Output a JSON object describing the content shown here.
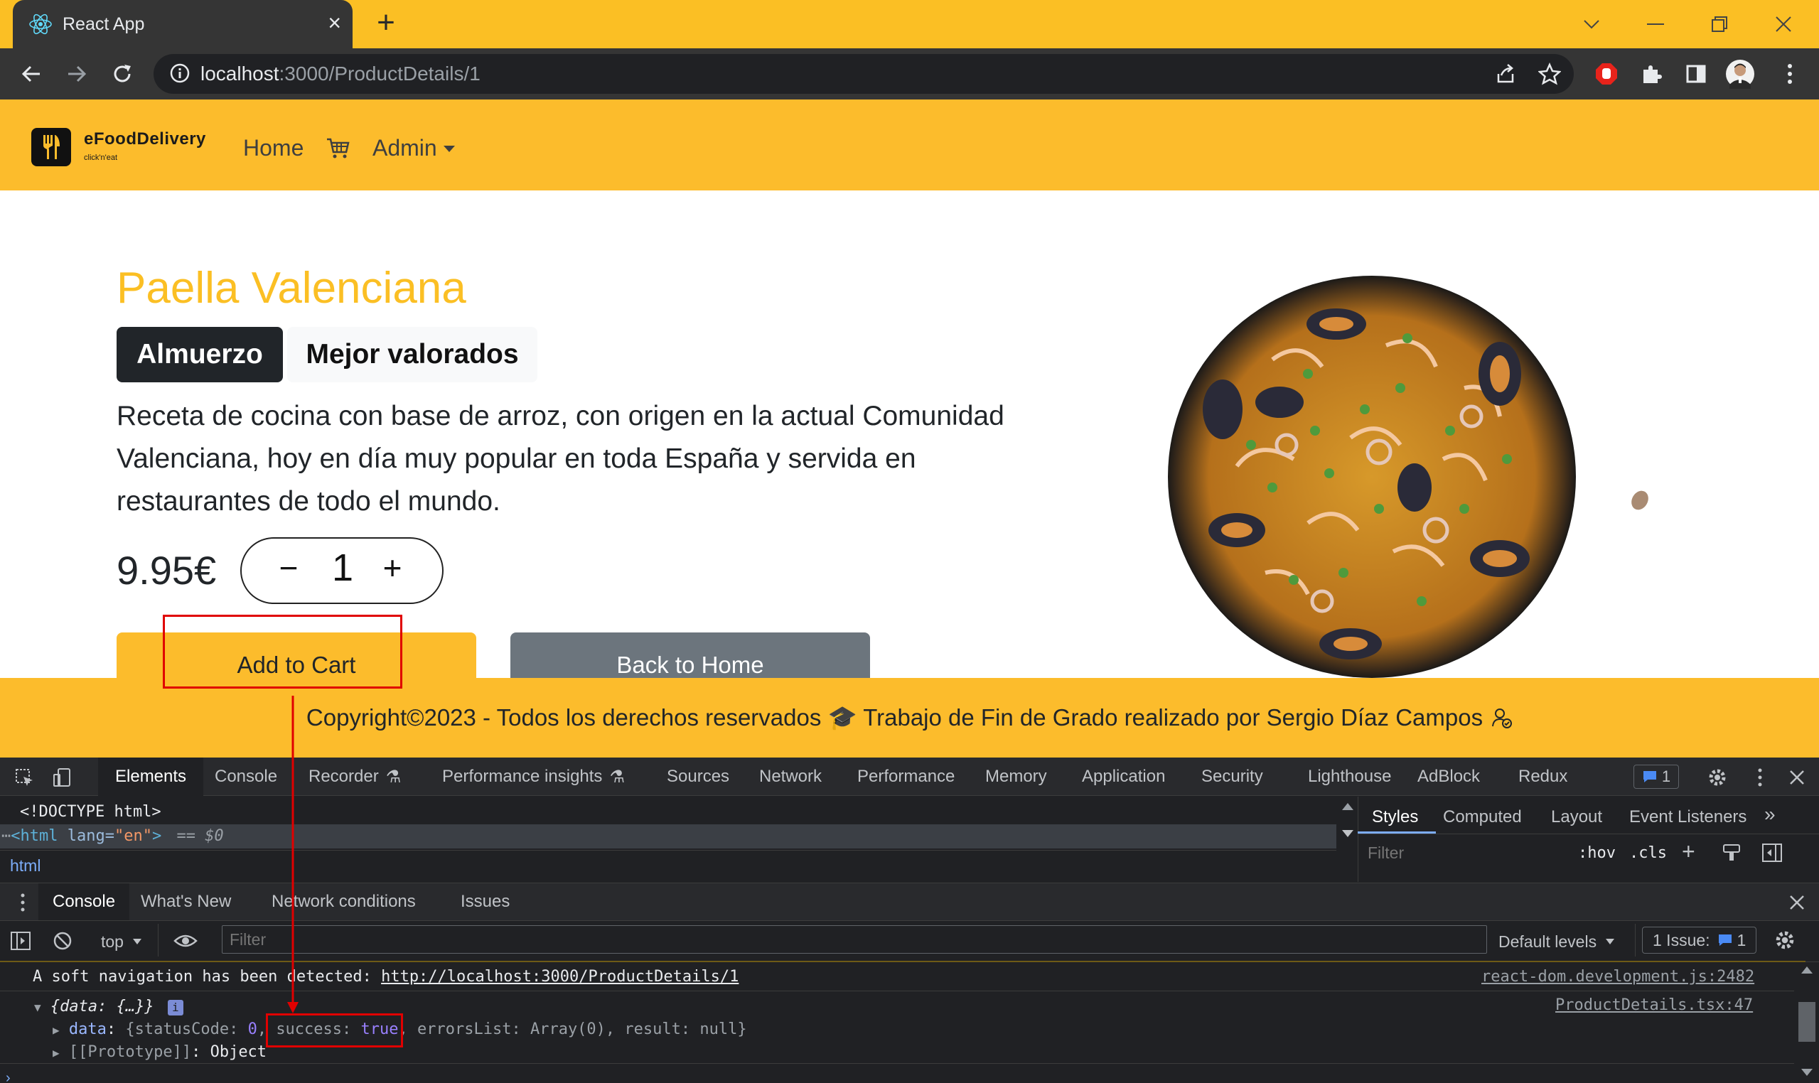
{
  "browser": {
    "tab_title": "React App",
    "url_host": "localhost",
    "url_path": ":3000/ProductDetails/1"
  },
  "navbar": {
    "brand": "eFoodDelivery",
    "brand_tagline": "click'n'eat",
    "home": "Home",
    "admin": "Admin"
  },
  "product": {
    "name": "Paella Valenciana",
    "category": "Almuerzo",
    "special_tag": "Mejor valorados",
    "description": "Receta de cocina con base de arroz, con origen en la actual Comunidad Valenciana, hoy en día muy popular en toda España y servida en restaurantes de todo el mundo.",
    "price": "9.95€",
    "quantity": "1",
    "add_to_cart": "Add to Cart",
    "back_home": "Back to Home"
  },
  "footer": {
    "text": "Copyright©2023 - Todos los derechos reservados 🎓 Trabajo de Fin de Grado realizado por Sergio Díaz Campos"
  },
  "devtools": {
    "tabs": [
      "Elements",
      "Console",
      "Recorder",
      "Performance insights",
      "Sources",
      "Network",
      "Performance",
      "Memory",
      "Application",
      "Security",
      "Lighthouse",
      "AdBlock",
      "Redux"
    ],
    "issues_badge": "1",
    "dom_doctype": "<!DOCTYPE html>",
    "dom_html_tag": "<html",
    "dom_html_attr": "lang",
    "dom_html_attr_val": "\"en\"",
    "dom_html_close": ">",
    "dom_selected_marker": "== $0",
    "breadcrumb": "html",
    "styles_tabs": [
      "Styles",
      "Computed",
      "Layout",
      "Event Listeners"
    ],
    "styles_filter_placeholder": "Filter",
    "hov": ":hov",
    "cls": ".cls",
    "drawer_tabs": [
      "Console",
      "What's New",
      "Network conditions",
      "Issues"
    ],
    "context": "top",
    "console_filter_placeholder": "Filter",
    "default_levels": "Default levels",
    "issues_count_label": "1 Issue:",
    "issues_count": "1",
    "console": {
      "line1_text": "A soft navigation has been detected: ",
      "line1_link": "http://localhost:3000/ProductDetails/1",
      "line1_source": "react-dom.development.js:2482",
      "line2_obj": "{data: {…}}",
      "line2_source": "ProductDetails.tsx:47",
      "line3_key": "data",
      "line3_pre": "{statusCode: ",
      "line3_status": "0",
      "line3_success_key": "success: ",
      "line3_success_val": "true",
      "line3_rest": "errorsList: Array(0), result: ",
      "line3_result": "null",
      "line4_key": "[[Prototype]]",
      "line4_val": "Object"
    }
  },
  "colors": {
    "brand_yellow": "#fcbc2c",
    "title_yellow": "#fbbf24",
    "annotation_red": "#e00000"
  }
}
